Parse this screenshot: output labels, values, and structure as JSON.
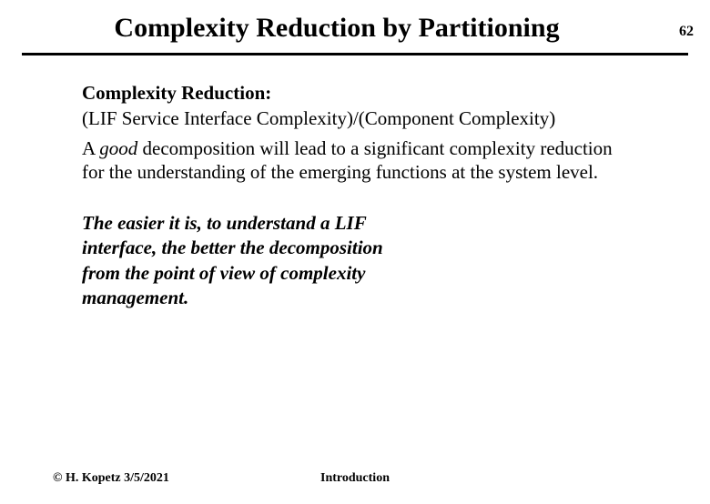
{
  "page_number": "62",
  "title": "Complexity Reduction by Partitioning",
  "content": {
    "subheading": "Complexity Reduction:",
    "formula": "(LIF Service Interface Complexity)/(Component Complexity)",
    "body_prefix": "A ",
    "body_emph": "good",
    "body_suffix": " decomposition will lead to a significant complexity reduction for the understanding of the emerging functions at the system level.",
    "italic_block": "The easier it is, to understand a LIF interface, the better the decomposition from the point of view of complexity management."
  },
  "footer": {
    "copyright": "© H. Kopetz 3/5/2021",
    "center": "Introduction"
  }
}
